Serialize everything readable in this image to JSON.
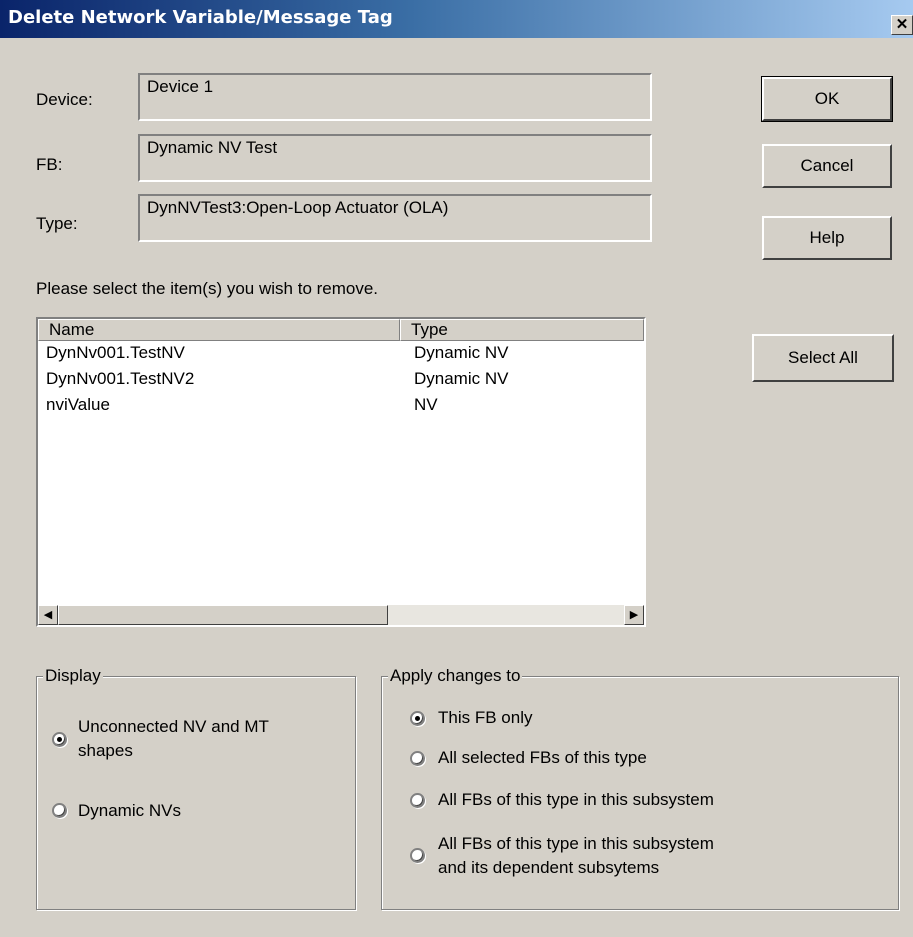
{
  "window": {
    "title": "Delete Network Variable/Message Tag",
    "close_glyph": "✕"
  },
  "fields": {
    "device_label": "Device:",
    "device_value": "Device 1",
    "fb_label": "FB:",
    "fb_value": "Dynamic NV Test",
    "type_label": "Type:",
    "type_value": "DynNVTest3:Open-Loop Actuator (OLA)"
  },
  "buttons": {
    "ok": "OK",
    "cancel": "Cancel",
    "help": "Help",
    "select_all": "Select All"
  },
  "instruction": "Please select the item(s) you wish to remove.",
  "list": {
    "columns": [
      "Name",
      "Type"
    ],
    "rows": [
      {
        "name": "DynNv001.TestNV",
        "type": "Dynamic NV"
      },
      {
        "name": "DynNv001.TestNV2",
        "type": "Dynamic NV"
      },
      {
        "name": "nviValue",
        "type": "NV"
      }
    ],
    "scroll_left_glyph": "◀",
    "scroll_right_glyph": "▶"
  },
  "display_group": {
    "legend": "Display",
    "options": [
      {
        "label_line1": "Unconnected NV and MT",
        "label_line2": "shapes",
        "checked": true
      },
      {
        "label_line1": "Dynamic NVs",
        "label_line2": "",
        "checked": false
      }
    ]
  },
  "apply_group": {
    "legend": "Apply changes to",
    "options": [
      {
        "label_line1": "This FB only",
        "label_line2": "",
        "checked": true
      },
      {
        "label_line1": "All selected FBs of this type",
        "label_line2": "",
        "checked": false
      },
      {
        "label_line1": "All FBs of this type in this subsystem",
        "label_line2": "",
        "checked": false
      },
      {
        "label_line1": "All FBs of this type in this subsystem",
        "label_line2": "and its dependent subsytems",
        "checked": false
      }
    ]
  }
}
